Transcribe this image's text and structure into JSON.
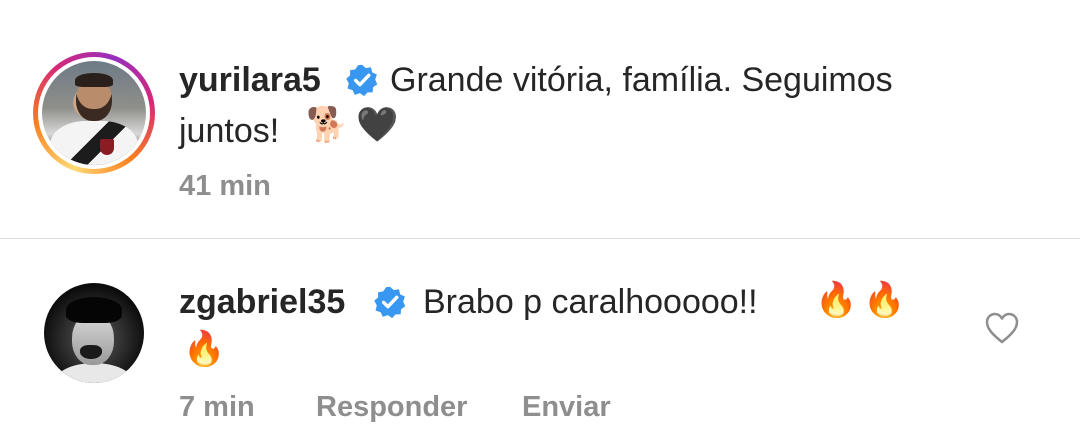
{
  "post_caption": {
    "username": "yurilara5",
    "verified_icon": "verified-badge-icon",
    "text_line1": "Grande vitória, família. Seguimos",
    "text_line2": "juntos!",
    "emoji_1": "🐕",
    "emoji_2": "🖤",
    "time": "41 min"
  },
  "comments": [
    {
      "username": "zgabriel35",
      "verified_icon": "verified-badge-icon",
      "text": "Brabo p caralhooooo!!",
      "emojis": [
        "🔥",
        "🔥",
        "🔥"
      ],
      "time": "7 min",
      "reply_label": "Responder",
      "send_label": "Enviar",
      "like_icon": "heart-outline-icon"
    }
  ],
  "colors": {
    "primary_text": "#262626",
    "secondary_text": "#8e8e8e",
    "verified_blue": "#3897f0",
    "divider": "#dbdbdb"
  }
}
